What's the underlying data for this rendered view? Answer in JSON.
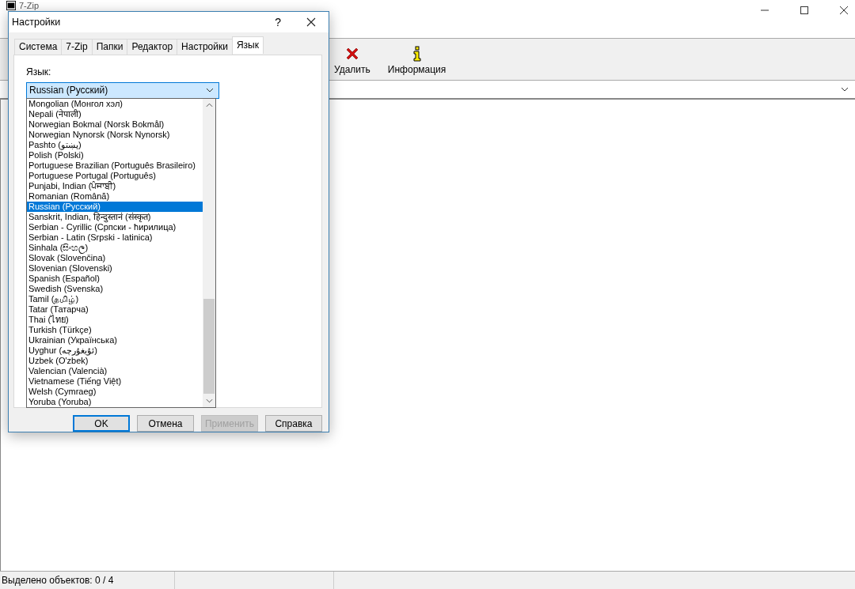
{
  "main_window": {
    "title": "7-Zip",
    "toolbar": [
      {
        "label": "Удалить",
        "kind": "delete"
      },
      {
        "label": "Информация",
        "kind": "info"
      }
    ],
    "status_bar": [
      "Выделено объектов: 0 / 4"
    ]
  },
  "dialog": {
    "title": "Настройки",
    "help": "?",
    "tabs": [
      {
        "label": "Система",
        "selected": false
      },
      {
        "label": "7-Zip",
        "selected": false
      },
      {
        "label": "Папки",
        "selected": false
      },
      {
        "label": "Редактор",
        "selected": false
      },
      {
        "label": "Настройки",
        "selected": false
      },
      {
        "label": "Язык",
        "selected": true
      }
    ],
    "language_label": "Язык:",
    "language_combo": {
      "value": "Russian (Русский)",
      "expanded": true
    },
    "language_list": [
      {
        "label": "Mongolian (Монгол хэл)",
        "selected": false
      },
      {
        "label": "Nepali (नेपाली)",
        "selected": false
      },
      {
        "label": "Norwegian Bokmal (Norsk Bokmål)",
        "selected": false
      },
      {
        "label": "Norwegian Nynorsk (Norsk Nynorsk)",
        "selected": false
      },
      {
        "label": "Pashto (پښتو)",
        "selected": false
      },
      {
        "label": "Polish (Polski)",
        "selected": false
      },
      {
        "label": "Portuguese Brazilian (Português Brasileiro)",
        "selected": false
      },
      {
        "label": "Portuguese Portugal (Português)",
        "selected": false
      },
      {
        "label": "Punjabi, Indian (ਪੰਜਾਬੀ)",
        "selected": false
      },
      {
        "label": "Romanian (Română)",
        "selected": false
      },
      {
        "label": "Russian (Русский)",
        "selected": true
      },
      {
        "label": "Sanskrit, Indian, हिन्दुस्तानं (संस्कृत)",
        "selected": false
      },
      {
        "label": "Serbian - Cyrillic (Српски - ћирилица)",
        "selected": false
      },
      {
        "label": "Serbian - Latin (Srpski - latinica)",
        "selected": false
      },
      {
        "label": "Sinhala (සිංහල)",
        "selected": false
      },
      {
        "label": "Slovak (Slovenčina)",
        "selected": false
      },
      {
        "label": "Slovenian (Slovenski)",
        "selected": false
      },
      {
        "label": "Spanish (Español)",
        "selected": false
      },
      {
        "label": "Swedish (Svenska)",
        "selected": false
      },
      {
        "label": "Tamil (தமிழ்)",
        "selected": false
      },
      {
        "label": "Tatar (Татарча)",
        "selected": false
      },
      {
        "label": "Thai (ไทย)",
        "selected": false
      },
      {
        "label": "Turkish (Türkçe)",
        "selected": false
      },
      {
        "label": "Ukrainian (Українська)",
        "selected": false
      },
      {
        "label": "Uyghur (ئۇيغۇرچە)",
        "selected": false
      },
      {
        "label": "Uzbek (O'zbek)",
        "selected": false
      },
      {
        "label": "Valencian (Valencià)",
        "selected": false
      },
      {
        "label": "Vietnamese (Tiếng Việt)",
        "selected": false
      },
      {
        "label": "Welsh (Cymraeg)",
        "selected": false
      },
      {
        "label": "Yoruba (Yoruba)",
        "selected": false
      }
    ],
    "buttons": [
      {
        "label": "OK",
        "default": true,
        "disabled": false
      },
      {
        "label": "Отмена",
        "default": false,
        "disabled": false
      },
      {
        "label": "Применить",
        "default": false,
        "disabled": true
      },
      {
        "label": "Справка",
        "default": false,
        "disabled": false
      }
    ]
  }
}
